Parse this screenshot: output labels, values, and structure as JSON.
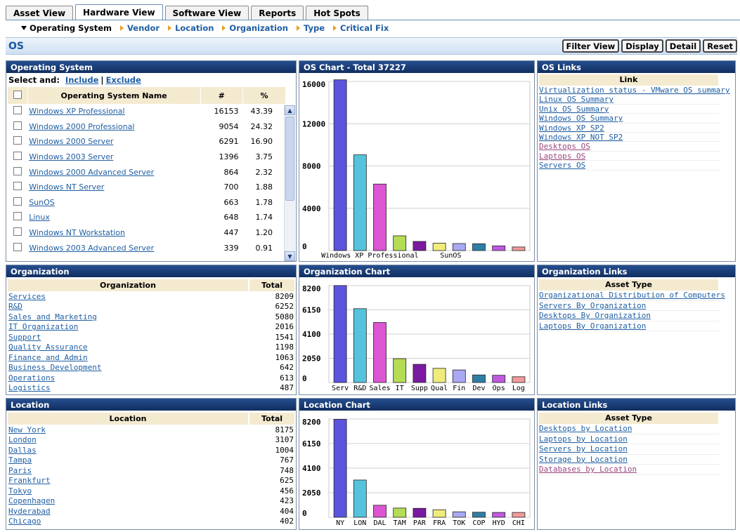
{
  "tabs": [
    "Asset View",
    "Hardware View",
    "Software View",
    "Reports",
    "Hot Spots"
  ],
  "active_tab": 1,
  "subnav": [
    "Operating System",
    "Vendor",
    "Location",
    "Organization",
    "Type",
    "Critical Fix"
  ],
  "active_subnav": 0,
  "page_title": "OS",
  "actions": [
    "Filter View",
    "Display",
    "Detail",
    "Reset"
  ],
  "os_panel": {
    "title": "Operating System",
    "select_label": "Select and:",
    "include": "Include",
    "sep": "|",
    "exclude": "Exclude",
    "columns": [
      "Operating System Name",
      "#",
      "%"
    ],
    "rows": [
      {
        "name": "Windows XP Professional",
        "count": "16153",
        "pct": "43.39"
      },
      {
        "name": "Windows 2000 Professional",
        "count": "9054",
        "pct": "24.32"
      },
      {
        "name": "Windows 2000 Server",
        "count": "6291",
        "pct": "16.90"
      },
      {
        "name": "Windows 2003 Server",
        "count": "1396",
        "pct": "3.75"
      },
      {
        "name": "Windows 2000 Advanced Server",
        "count": "864",
        "pct": "2.32"
      },
      {
        "name": "Windows NT Server",
        "count": "700",
        "pct": "1.88"
      },
      {
        "name": "SunOS",
        "count": "663",
        "pct": "1.78"
      },
      {
        "name": "Linux",
        "count": "648",
        "pct": "1.74"
      },
      {
        "name": "Windows NT Workstation",
        "count": "447",
        "pct": "1.20"
      },
      {
        "name": "Windows 2003 Advanced Server",
        "count": "339",
        "pct": "0.91"
      }
    ]
  },
  "os_links": {
    "title": "OS Links",
    "header": "Link",
    "links": [
      {
        "label": "Virtualization status - VMware OS summary",
        "visited": false
      },
      {
        "label": "Linux OS Summary",
        "visited": false
      },
      {
        "label": "Unix OS Summary",
        "visited": false
      },
      {
        "label": "Windows OS Summary",
        "visited": false
      },
      {
        "label": "Windows XP SP2",
        "visited": false
      },
      {
        "label": "Windows XP NOT SP2",
        "visited": false
      },
      {
        "label": "Desktops OS",
        "visited": true
      },
      {
        "label": "Laptops OS",
        "visited": true
      },
      {
        "label": "Servers OS",
        "visited": false
      }
    ]
  },
  "org_panel": {
    "title": "Organization",
    "columns": [
      "Organization",
      "Total"
    ],
    "rows": [
      {
        "name": "Services",
        "total": "8209"
      },
      {
        "name": "R&D",
        "total": "6252"
      },
      {
        "name": "Sales and Marketing",
        "total": "5080"
      },
      {
        "name": "IT Organization",
        "total": "2016"
      },
      {
        "name": "Support",
        "total": "1541"
      },
      {
        "name": "Quality Assurance",
        "total": "1198"
      },
      {
        "name": "Finance and Admin",
        "total": "1063"
      },
      {
        "name": "Business Development",
        "total": "642"
      },
      {
        "name": "Operations",
        "total": "613"
      },
      {
        "name": "Logistics",
        "total": "487"
      }
    ]
  },
  "org_links": {
    "title": "Organization Links",
    "header": "Asset Type",
    "links": [
      {
        "label": "Organizational Distribution of Computers",
        "visited": false
      },
      {
        "label": "Servers By Organization",
        "visited": false
      },
      {
        "label": "Desktops By Organization",
        "visited": false
      },
      {
        "label": "Laptops By Organization",
        "visited": false
      }
    ]
  },
  "loc_panel": {
    "title": "Location",
    "columns": [
      "Location",
      "Total"
    ],
    "rows": [
      {
        "name": "New York",
        "total": "8175"
      },
      {
        "name": "London",
        "total": "3107"
      },
      {
        "name": "Dallas",
        "total": "1004"
      },
      {
        "name": "Tampa",
        "total": "767"
      },
      {
        "name": "Paris",
        "total": "748"
      },
      {
        "name": "Frankfurt",
        "total": "625"
      },
      {
        "name": "Tokyo",
        "total": "456"
      },
      {
        "name": "Copenhagen",
        "total": "423"
      },
      {
        "name": "Hyderabad",
        "total": "404"
      },
      {
        "name": "Chicago",
        "total": "402"
      }
    ]
  },
  "loc_links": {
    "title": "Location Links",
    "header": "Asset Type",
    "links": [
      {
        "label": "Desktops by Location",
        "visited": false
      },
      {
        "label": "Laptops by Location",
        "visited": false
      },
      {
        "label": "Servers by Location",
        "visited": false
      },
      {
        "label": "Storage by Location",
        "visited": false
      },
      {
        "label": "Databases by Location",
        "visited": true
      }
    ]
  },
  "bar_colors": [
    "#5a55dc",
    "#55c3dc",
    "#dc55d2",
    "#b4dc55",
    "#7a1aa0",
    "#f0ec7c",
    "#a9a9f3",
    "#2f7fa5",
    "#c059e0",
    "#f39a9a"
  ],
  "chart_data": [
    {
      "type": "bar",
      "title": "OS Chart - Total 37227",
      "categories": [
        "Windows XP Professional",
        "Windows 2000 Professional",
        "Windows 2000 Server",
        "Windows 2003 Server",
        "Windows 2000 Advanced Server",
        "Windows NT Server",
        "SunOS",
        "Linux",
        "Windows NT Workstation",
        "Windows 2003 Advanced Server"
      ],
      "values": [
        16153,
        9054,
        6291,
        1396,
        864,
        700,
        663,
        648,
        447,
        339
      ],
      "ylim": [
        0,
        16000
      ],
      "yticks": [
        "0",
        "4000",
        "8000",
        "12000",
        "16000"
      ],
      "xlabels": [
        {
          "index": 0,
          "text": "Windows XP Professional"
        },
        {
          "index": 6,
          "text": "SunOS"
        }
      ],
      "grid": true
    },
    {
      "type": "bar",
      "title": "Organization Chart",
      "categories": [
        "Serv",
        "R&D",
        "Sales",
        "IT",
        "Supp",
        "Qual",
        "Fin",
        "Dev",
        "Ops",
        "Log"
      ],
      "values": [
        8209,
        6252,
        5080,
        2016,
        1541,
        1198,
        1063,
        642,
        613,
        487
      ],
      "ylim": [
        0,
        8200
      ],
      "yticks": [
        "0",
        "2050",
        "4100",
        "6150",
        "8200"
      ],
      "grid": true
    },
    {
      "type": "bar",
      "title": "Location Chart",
      "categories": [
        "NY",
        "LON",
        "DAL",
        "TAM",
        "PAR",
        "FRA",
        "TOK",
        "COP",
        "HYD",
        "CHI"
      ],
      "values": [
        8175,
        3107,
        1004,
        767,
        748,
        625,
        456,
        423,
        404,
        402
      ],
      "ylim": [
        0,
        8200
      ],
      "yticks": [
        "0",
        "2050",
        "4100",
        "6150",
        "8200"
      ],
      "grid": true
    }
  ]
}
